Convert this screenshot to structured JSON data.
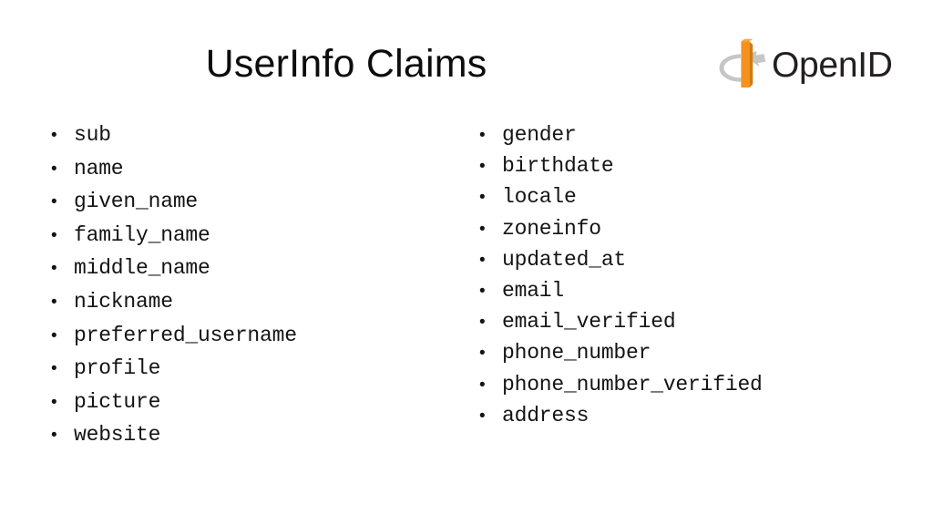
{
  "slide": {
    "title": "UserInfo Claims",
    "background_color": "#ffffff",
    "text_color": "#141414"
  },
  "logo": {
    "name": "openid-logo",
    "wordmark": "OpenID",
    "mark_ring_color": "#c6c6c6",
    "mark_bar_color": "#f5911e",
    "mark_bar_shadow_color": "#d07a12",
    "wordmark_color": "#231f20"
  },
  "bullet_glyph": "•",
  "columns": {
    "left": {
      "name": "claims-column-left",
      "items": [
        "sub",
        "name",
        "given_name",
        "family_name",
        "middle_name",
        "nickname",
        "preferred_username",
        "profile",
        "picture",
        "website"
      ]
    },
    "right": {
      "name": "claims-column-right",
      "items": [
        "gender",
        "birthdate",
        "locale",
        "zoneinfo",
        "updated_at",
        "email",
        "email_verified",
        "phone_number",
        "phone_number_verified",
        "address"
      ]
    }
  }
}
